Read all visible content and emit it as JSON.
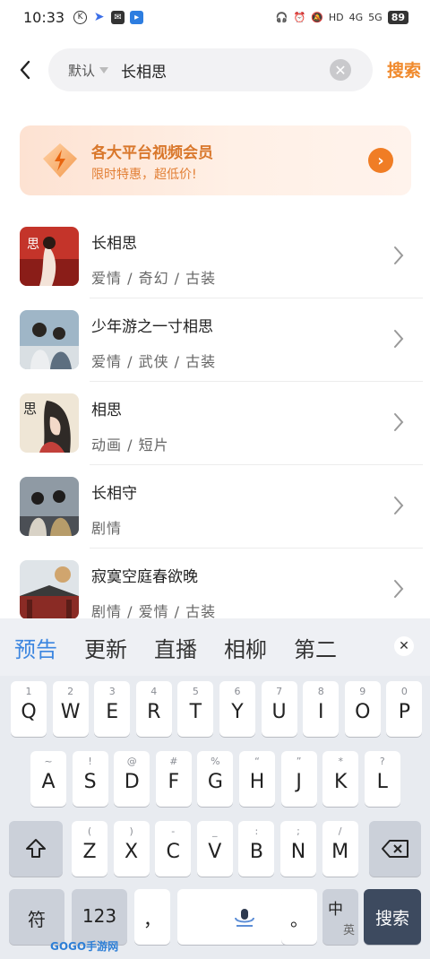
{
  "status_bar": {
    "time": "10:33",
    "signal_4g": "4G",
    "signal_5g": "5G",
    "hd": "HD",
    "battery": "89"
  },
  "search": {
    "filter_label": "默认",
    "query": "长相思",
    "button_label": "搜索"
  },
  "promo": {
    "title": "各大平台视频会员",
    "subtitle": "限时特惠，超低价!"
  },
  "results": [
    {
      "title": "长相思",
      "tags": "爱情 / 奇幻 / 古装",
      "thumb_text": "思"
    },
    {
      "title": "少年游之一寸相思",
      "tags": "爱情 / 武侠 / 古装"
    },
    {
      "title": "相思",
      "tags": "动画 / 短片",
      "thumb_text": "思"
    },
    {
      "title": "长相守",
      "tags": "剧情"
    },
    {
      "title": "寂寞空庭春欲晚",
      "tags": "剧情 / 爱情 / 古装"
    }
  ],
  "keyboard": {
    "suggestions": [
      "预告",
      "更新",
      "直播",
      "相柳",
      "第二"
    ],
    "row1": [
      {
        "k": "Q",
        "h": "1"
      },
      {
        "k": "W",
        "h": "2"
      },
      {
        "k": "E",
        "h": "3"
      },
      {
        "k": "R",
        "h": "4"
      },
      {
        "k": "T",
        "h": "5"
      },
      {
        "k": "Y",
        "h": "6"
      },
      {
        "k": "U",
        "h": "7"
      },
      {
        "k": "I",
        "h": "8"
      },
      {
        "k": "O",
        "h": "9"
      },
      {
        "k": "P",
        "h": "0"
      }
    ],
    "row2": [
      {
        "k": "A",
        "h": "~"
      },
      {
        "k": "S",
        "h": "!"
      },
      {
        "k": "D",
        "h": "@"
      },
      {
        "k": "F",
        "h": "#"
      },
      {
        "k": "G",
        "h": "%"
      },
      {
        "k": "H",
        "h": "“"
      },
      {
        "k": "J",
        "h": "”"
      },
      {
        "k": "K",
        "h": "*"
      },
      {
        "k": "L",
        "h": "?"
      }
    ],
    "row3": [
      {
        "k": "Z",
        "h": "("
      },
      {
        "k": "X",
        "h": ")"
      },
      {
        "k": "C",
        "h": "-"
      },
      {
        "k": "V",
        "h": "_"
      },
      {
        "k": "B",
        "h": ":"
      },
      {
        "k": "N",
        "h": ";"
      },
      {
        "k": "M",
        "h": "/"
      }
    ],
    "symbols_label": "符",
    "numbers_label": "123",
    "comma": "，",
    "period": "。",
    "lang_main": "中",
    "lang_sub": "英",
    "enter_label": "搜索"
  },
  "watermark": "GOGO手游网",
  "colors": {
    "accent": "#f08a2d",
    "suggest_active": "#3c86e0",
    "enter_key": "#3d4a5f"
  }
}
